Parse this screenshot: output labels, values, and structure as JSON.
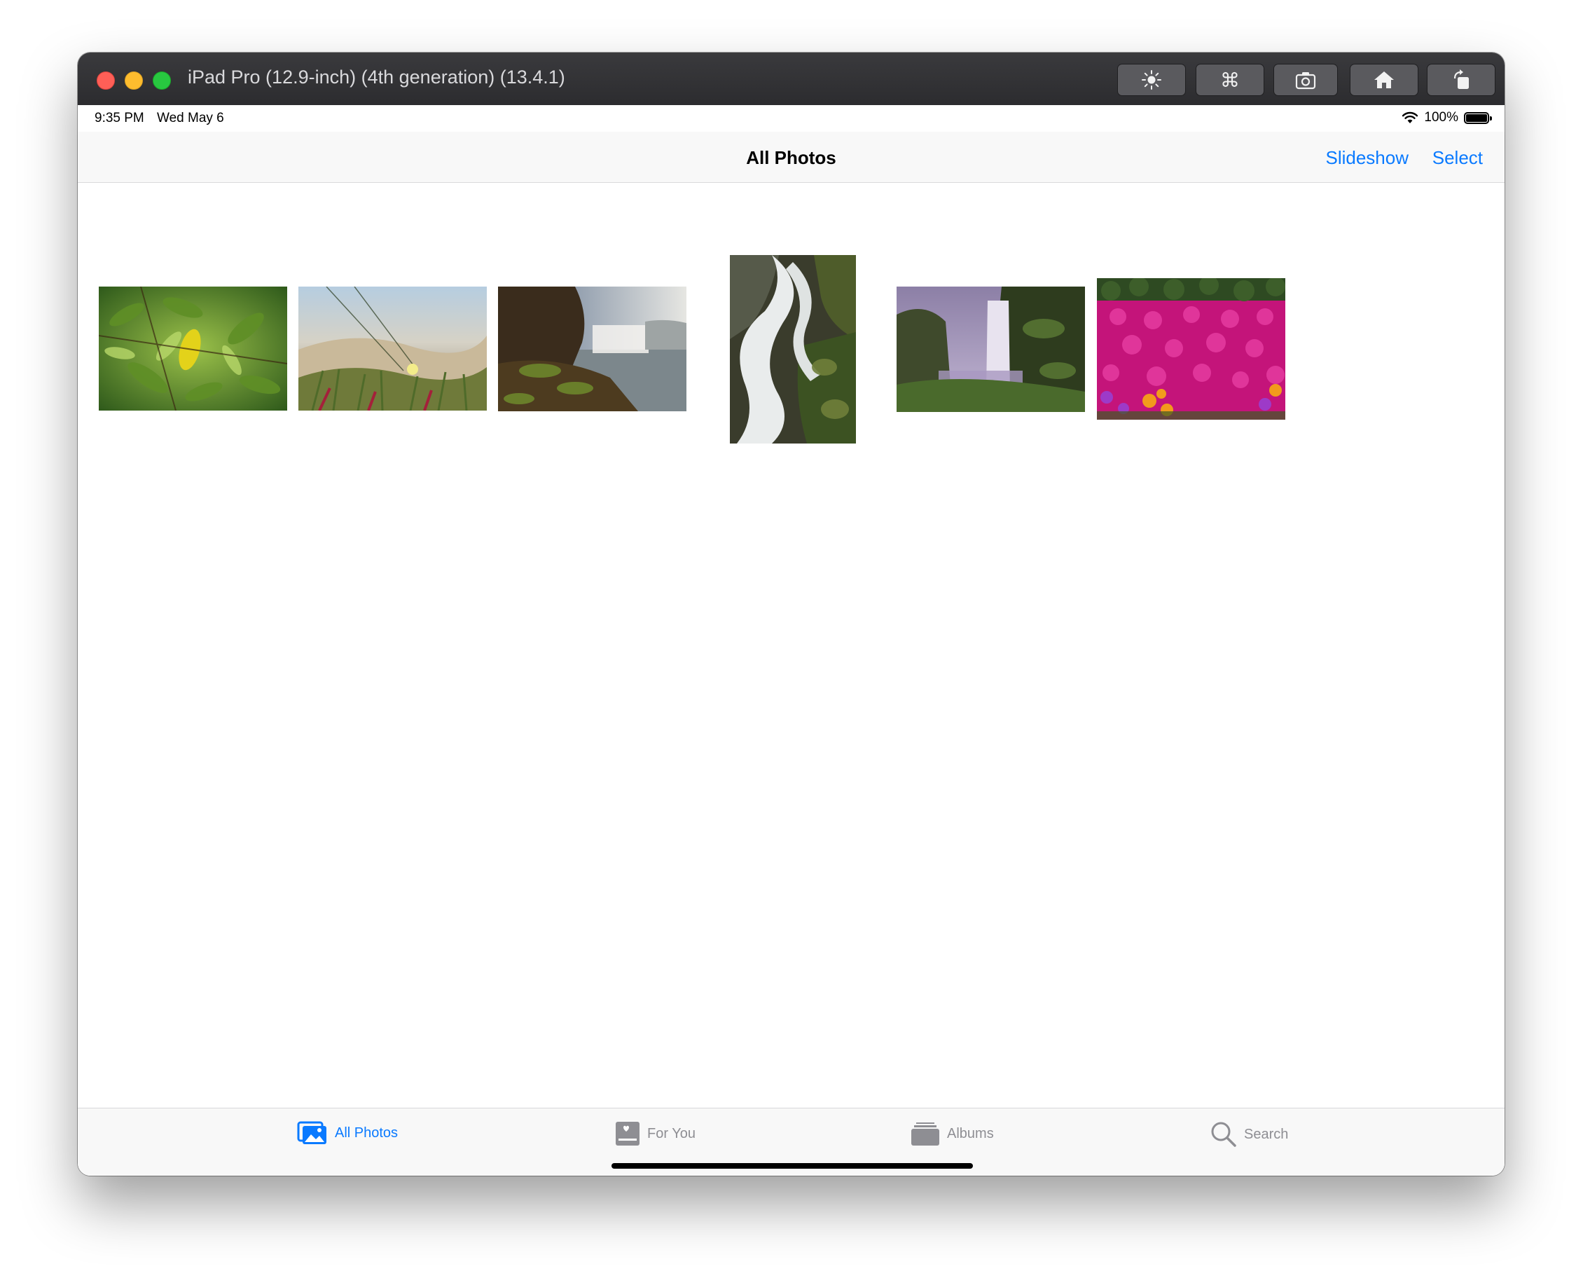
{
  "window": {
    "title": "iPad Pro (12.9-inch) (4th generation) (13.4.1)",
    "toolbar_icons": [
      "brightness-icon",
      "command-icon",
      "screenshot-icon",
      "home-icon",
      "rotate-icon"
    ]
  },
  "status_bar": {
    "time": "9:35 PM",
    "date": "Wed May 6",
    "battery": "100%"
  },
  "nav": {
    "title": "All Photos",
    "slideshow_label": "Slideshow",
    "select_label": "Select"
  },
  "photos": [
    {
      "subject": "green-leaves-yellow-leaf"
    },
    {
      "subject": "dune-grass-yellow-flower"
    },
    {
      "subject": "mossy-rocks-waterfall-lake"
    },
    {
      "subject": "long-exposure-waterfall-portrait"
    },
    {
      "subject": "skogafoss-waterfall-mist"
    },
    {
      "subject": "magenta-flowers-field"
    }
  ],
  "tabs": [
    {
      "label": "All Photos",
      "icon": "photos-icon",
      "active": true
    },
    {
      "label": "For You",
      "icon": "for-you-icon",
      "active": false
    },
    {
      "label": "Albums",
      "icon": "albums-icon",
      "active": false
    },
    {
      "label": "Search",
      "icon": "search-icon",
      "active": false
    }
  ],
  "colors": {
    "accent": "#0a7aff",
    "inactive_tab": "#8e8e93"
  }
}
